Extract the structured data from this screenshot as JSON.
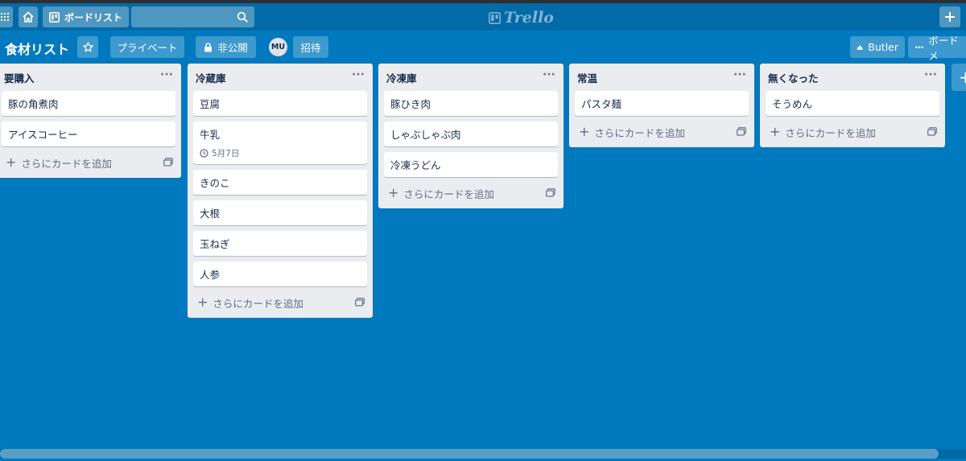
{
  "header": {
    "boards_label": "ボードリスト",
    "logo_text": "Trello"
  },
  "board": {
    "title": "食材リスト",
    "visibility_label": "プライベート",
    "privacy_label": "非公開",
    "member_initials": "MU",
    "invite_label": "招待",
    "butler_label": "Butler",
    "menu_label": "ボードメ"
  },
  "add_card_label": "さらにカードを追加",
  "lists": [
    {
      "title": "要購入",
      "cards": [
        {
          "title": "豚の角煮肉"
        },
        {
          "title": "アイスコーヒー"
        }
      ]
    },
    {
      "title": "冷蔵庫",
      "cards": [
        {
          "title": "豆腐"
        },
        {
          "title": "牛乳",
          "due": "5月7日"
        },
        {
          "title": "きのこ"
        },
        {
          "title": "大根"
        },
        {
          "title": "玉ねぎ"
        },
        {
          "title": "人参"
        }
      ]
    },
    {
      "title": "冷凍庫",
      "cards": [
        {
          "title": "豚ひき肉"
        },
        {
          "title": "しゃぶしゃぶ肉"
        },
        {
          "title": "冷凍うどん"
        }
      ]
    },
    {
      "title": "常温",
      "cards": [
        {
          "title": "パスタ麺"
        }
      ]
    },
    {
      "title": "無くなった",
      "cards": [
        {
          "title": "そうめん"
        }
      ]
    }
  ],
  "colors": {
    "board_bg": "#0079bf",
    "header_bg": "#026aa7",
    "list_bg": "#ebecf0"
  }
}
